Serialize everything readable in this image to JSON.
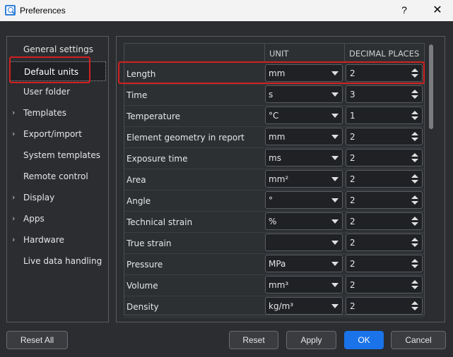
{
  "window": {
    "title": "Preferences",
    "help_label": "?",
    "close_label": "✕"
  },
  "sidebar": {
    "items": [
      {
        "label": "General settings",
        "expandable": false
      },
      {
        "label": "Default units",
        "expandable": false,
        "selected": true
      },
      {
        "label": "User folder",
        "expandable": false
      },
      {
        "label": "Templates",
        "expandable": true
      },
      {
        "label": "Export/import",
        "expandable": true
      },
      {
        "label": "System templates",
        "expandable": false
      },
      {
        "label": "Remote control",
        "expandable": false
      },
      {
        "label": "Display",
        "expandable": true
      },
      {
        "label": "Apps",
        "expandable": true
      },
      {
        "label": "Hardware",
        "expandable": true
      },
      {
        "label": "Live data handling",
        "expandable": false
      }
    ],
    "chevron_glyph": "›"
  },
  "table": {
    "columns": {
      "unit": "UNIT",
      "decimals": "DECIMAL PLACES"
    },
    "rows": [
      {
        "name": "Length",
        "unit": "mm",
        "decimals": "2"
      },
      {
        "name": "Time",
        "unit": "s",
        "decimals": "3"
      },
      {
        "name": "Temperature",
        "unit": "°C",
        "decimals": "1"
      },
      {
        "name": "Element geometry in report",
        "unit": "mm",
        "decimals": "2"
      },
      {
        "name": "Exposure time",
        "unit": "ms",
        "decimals": "2"
      },
      {
        "name": "Area",
        "unit": "mm²",
        "decimals": "2"
      },
      {
        "name": "Angle",
        "unit": "°",
        "decimals": "2"
      },
      {
        "name": "Technical strain",
        "unit": "%",
        "decimals": "2"
      },
      {
        "name": "True strain",
        "unit": "",
        "decimals": "2"
      },
      {
        "name": "Pressure",
        "unit": "MPa",
        "decimals": "2"
      },
      {
        "name": "Volume",
        "unit": "mm³",
        "decimals": "2"
      },
      {
        "name": "Density",
        "unit": "kg/m³",
        "decimals": "2"
      }
    ]
  },
  "buttons": {
    "reset_all": "Reset All",
    "reset": "Reset",
    "apply": "Apply",
    "ok": "OK",
    "cancel": "Cancel"
  },
  "colors": {
    "accent": "#1a73e8",
    "highlight": "#d22020"
  }
}
